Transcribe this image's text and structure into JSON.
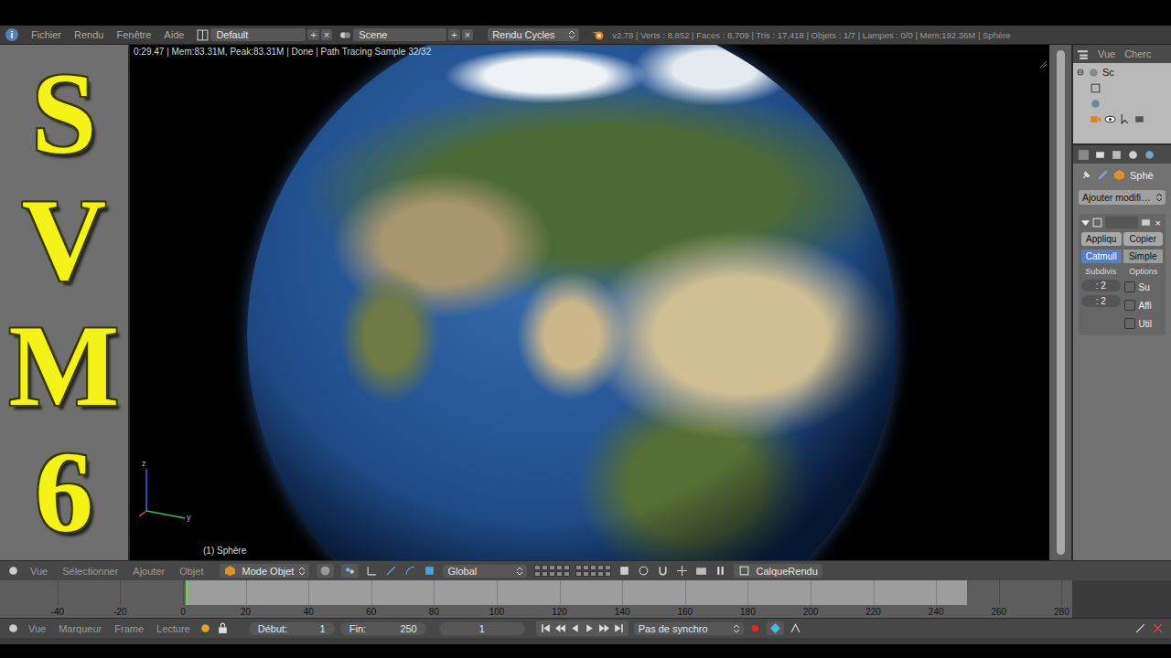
{
  "header": {
    "info_icon": "i",
    "menus": [
      "Fichier",
      "Rendu",
      "Fenêtre",
      "Aide"
    ],
    "layout": "Default",
    "scene": "Scene",
    "add": "+",
    "close": "×",
    "engine": "Rendu Cycles",
    "stats": "v2.78 | Verts : 8,852 | Faces : 8,709 | Tris : 17,418 | Objets : 1/7 | Lampes : 0/0 | Mem:192.36M | Sphère"
  },
  "channel_logo": "SVM6",
  "viewport": {
    "render_info": "0:29.47 | Mem:83.31M, Peak:83.31M | Done | Path Tracing Sample 32/32",
    "object_label": "(1) Sphère",
    "axis_labels": [
      "z",
      "y"
    ]
  },
  "outliner": {
    "menus": [
      "Vue",
      "Cherc"
    ],
    "items": [
      {
        "label": "Sc",
        "expanded": true
      }
    ]
  },
  "properties": {
    "object": "Sphè",
    "add_modifier": "Ajouter modifi…",
    "close": "×",
    "buttons": [
      "Appliqu",
      "Copier"
    ],
    "algorithms": [
      {
        "label": "Catmull",
        "selected": true
      },
      {
        "label": "Simple",
        "selected": false
      }
    ],
    "columns": [
      "Subdivis",
      "Options"
    ],
    "levels": [
      ": 2",
      ": 2"
    ],
    "options": [
      {
        "label": "Su",
        "checked": false
      },
      {
        "label": "Affi",
        "checked": false
      },
      {
        "label": "Util",
        "checked": false
      }
    ]
  },
  "viewport_header": {
    "menus": [
      "Vue",
      "Sélectionner",
      "Ajouter",
      "Objet"
    ],
    "mode": "Mode Objet",
    "orientation": "Global",
    "render_layer": "CalqueRendu"
  },
  "timeline": {
    "ticks": [
      "-40",
      "-20",
      "0",
      "20",
      "40",
      "60",
      "80",
      "100",
      "120",
      "140",
      "160",
      "180",
      "200",
      "220",
      "240",
      "260",
      "280"
    ]
  },
  "timeline_header": {
    "menus": [
      "Vue",
      "Marqueur",
      "Frame",
      "Lecture"
    ],
    "start_label": "Début:",
    "start": "1",
    "end_label": "Fin:",
    "end": "250",
    "current": "1",
    "sync": "Pas de synchro"
  }
}
